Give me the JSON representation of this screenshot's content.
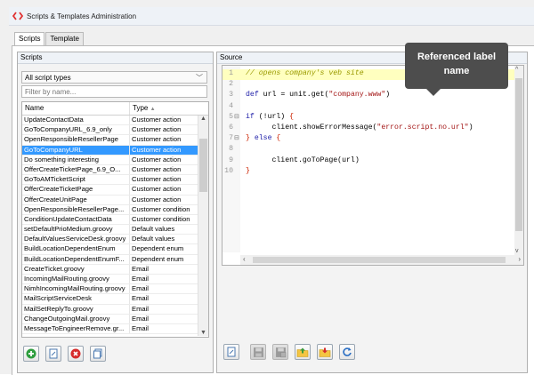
{
  "window": {
    "title": "Scripts & Templates Administration"
  },
  "tabs": [
    {
      "label": "Scripts"
    },
    {
      "label": "Template"
    }
  ],
  "scripts_panel": {
    "header": "Scripts",
    "type_filter": "All script types",
    "name_filter_placeholder": "Filter by name...",
    "columns": {
      "name": "Name",
      "type": "Type"
    },
    "sort_indicator": "▲",
    "rows": [
      [
        "UpdateContactData",
        "Customer action"
      ],
      [
        "GoToCompanyURL_6.9_only",
        "Customer action"
      ],
      [
        "OpenResponsibleResellerPage",
        "Customer action"
      ],
      [
        "GoToCompanyURL",
        "Customer action"
      ],
      [
        "Do something interesting",
        "Customer action"
      ],
      [
        "OfferCreateTicketPage_6.9_O...",
        "Customer action"
      ],
      [
        "GoToAMTicketScript",
        "Customer action"
      ],
      [
        "OfferCreateTicketPage",
        "Customer action"
      ],
      [
        "OfferCreateUnitPage",
        "Customer action"
      ],
      [
        "OpenResponsibleResellerPage...",
        "Customer condition"
      ],
      [
        "ConditionUpdateContactData",
        "Customer condition"
      ],
      [
        "setDefaultPrioMedium.groovy",
        "Default values"
      ],
      [
        "DefaultValuesServiceDesk.groovy",
        "Default values"
      ],
      [
        "BuildLocationDependentEnum",
        "Dependent enum"
      ],
      [
        "BuildLocationDependentEnumF...",
        "Dependent enum"
      ],
      [
        "CreateTicket.groovy",
        "Email"
      ],
      [
        "IncomingMailRouting.groovy",
        "Email"
      ],
      [
        "NimhIncomingMailRouting.groovy",
        "Email"
      ],
      [
        "MailScriptServiceDesk",
        "Email"
      ],
      [
        "MailSetReplyTo.groovy",
        "Email"
      ],
      [
        "ChangeOutgoingMail.groovy",
        "Email"
      ],
      [
        "MessageToEngineerRemove.gr...",
        "Email"
      ]
    ],
    "selected_row": 3
  },
  "source_panel": {
    "header": "Source",
    "lines": [
      {
        "n": "1",
        "fold": "",
        "hl": true,
        "parts": [
          [
            "cm",
            "// opens company's veb site"
          ]
        ]
      },
      {
        "n": "2",
        "fold": "",
        "hl": false,
        "parts": []
      },
      {
        "n": "3",
        "fold": "",
        "hl": false,
        "parts": [
          [
            "kw",
            "def"
          ],
          [
            "pl",
            " url = unit.get("
          ],
          [
            "st",
            "\"company.www\""
          ],
          [
            "pl",
            ")"
          ]
        ]
      },
      {
        "n": "4",
        "fold": "",
        "hl": false,
        "parts": []
      },
      {
        "n": "5",
        "fold": "⊟",
        "hl": false,
        "parts": [
          [
            "kw",
            "if"
          ],
          [
            "pl",
            " (!url) "
          ],
          [
            "brk",
            "{"
          ]
        ]
      },
      {
        "n": "6",
        "fold": "",
        "hl": false,
        "parts": [
          [
            "pl",
            "      client.showErrorMessage("
          ],
          [
            "st",
            "\"error.script.no.url\""
          ],
          [
            "pl",
            ")"
          ]
        ]
      },
      {
        "n": "7",
        "fold": "⊟",
        "hl": false,
        "parts": [
          [
            "brk",
            "}"
          ],
          [
            "pl",
            " "
          ],
          [
            "kw",
            "else"
          ],
          [
            "pl",
            " "
          ],
          [
            "brk",
            "{"
          ]
        ]
      },
      {
        "n": "8",
        "fold": "",
        "hl": false,
        "parts": []
      },
      {
        "n": "9",
        "fold": "",
        "hl": false,
        "parts": [
          [
            "pl",
            "      client.goToPage(url)"
          ]
        ]
      },
      {
        "n": "10",
        "fold": "",
        "hl": false,
        "parts": [
          [
            "brk",
            "}"
          ]
        ]
      }
    ]
  },
  "tooltip": {
    "text": "Referenced label name"
  },
  "colors": {
    "selection": "#3399ff",
    "highlight_line": "#ffffbf",
    "tooltip_bg": "#4d4d4d"
  },
  "left_toolbar": [
    "add-icon",
    "edit-icon",
    "delete-icon",
    "copy-icon"
  ],
  "right_toolbar": [
    "edit-icon",
    "save-icon",
    "save-as-icon",
    "open-folder-icon",
    "import-folder-icon",
    "refresh-icon"
  ]
}
